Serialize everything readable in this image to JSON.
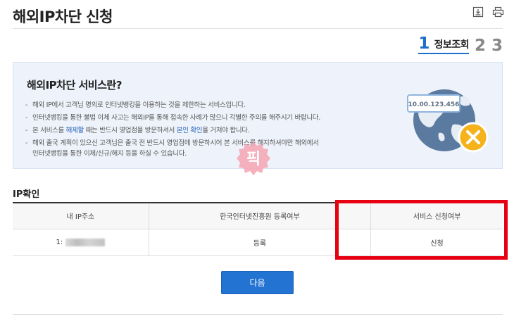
{
  "page": {
    "title": "해외IP차단 신청",
    "icons": [
      "download-icon",
      "print-icon"
    ]
  },
  "steps": {
    "current_number": "1",
    "current_label": "정보조회",
    "step2": "2",
    "step3": "3"
  },
  "info": {
    "title": "해외IP차단 서비스란?",
    "items": [
      {
        "text": "해외 IP에서 고객님 명의로 인터넷뱅킹을 이용하는 것을 제한하는 서비스입니다."
      },
      {
        "text": "인터넷뱅킹을 통한 불법 이체 사고는 해외IP를 통해 접속한 사례가 많으니 각별한 주의를 해주시기 바랍니다."
      },
      {
        "pre": "본 서비스를 ",
        "hl1": "해제할",
        "mid": " 때는 반드시 영업점을 방문하셔서 ",
        "hl2": "본인 확인",
        "post": "을 거쳐야 합니다."
      },
      {
        "line1": "해외 출국 계획이 있으신 고객님은 출국 전 반드시 영업점에 방문하시어 본 서비스를 해지하셔야만 해외에서",
        "line2": "인터넷뱅킹을 통한 이체/신규/해지 등을 하실 수 있습니다."
      }
    ],
    "illustration_ip": "10.00.123.456"
  },
  "watermark": "픽",
  "ip_section": {
    "title": "IP확인",
    "headers": [
      "내 IP주소",
      "한국인터넷진흥원 등록여부",
      "서비스 신청여부"
    ],
    "row": {
      "ip_prefix": "1:",
      "registered": "등록",
      "service_status": "신청"
    }
  },
  "actions": {
    "next_label": "다음"
  },
  "colors": {
    "accent": "#2373d2",
    "highlight": "#e60012",
    "info_bg": "#eef3fb"
  }
}
